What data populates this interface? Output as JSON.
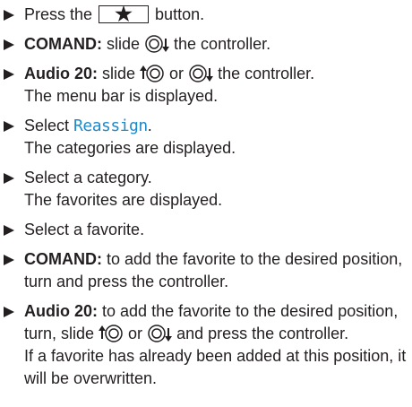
{
  "steps": [
    {
      "before": "Press the ",
      "key_label": "★",
      "after": " button."
    },
    {
      "label": "COMAND:",
      "before": " slide ",
      "after": " the controller."
    },
    {
      "label": "Audio 20:",
      "before": " slide ",
      "middle": " or ",
      "after": " the controller.",
      "result": "The menu bar is displayed."
    },
    {
      "before": "Select ",
      "menu_item": "Reassign",
      "after": ".",
      "result": "The categories are displayed."
    },
    {
      "text": "Select a category.",
      "result": "The favorites are displayed."
    },
    {
      "text": "Select a favorite."
    },
    {
      "label": "COMAND:",
      "text": " to add the favorite to the desired position, turn and press the controller."
    },
    {
      "label": "Audio 20:",
      "before": " to add the favorite to the desired position, turn, slide ",
      "middle": " or ",
      "after": " and press the controller.",
      "result": "If a favorite has already been added at this position, it will be overwritten."
    }
  ],
  "icons": {
    "bullet": "triangle-bullet-icon",
    "controller_up": "controller-slide-up-icon",
    "controller_down": "controller-slide-down-icon",
    "star_key": "star-key-icon"
  }
}
